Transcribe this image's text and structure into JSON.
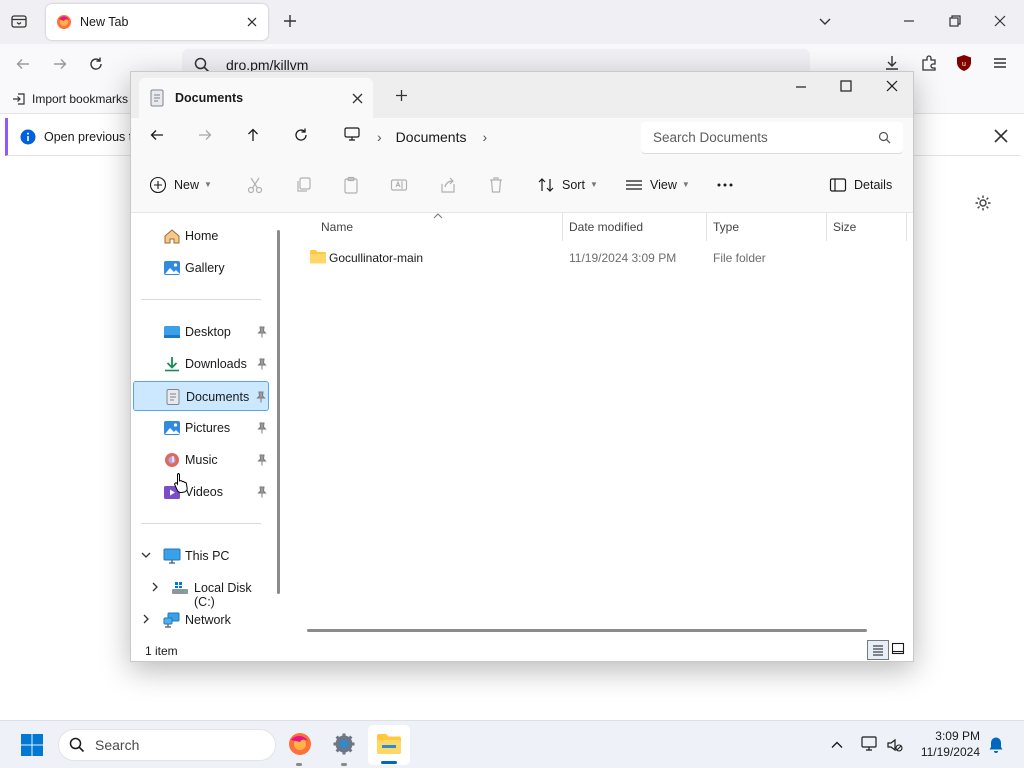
{
  "browser": {
    "tab_title": "New Tab",
    "url": "dro.pm/killvm",
    "bookmark_import": "Import bookmarks",
    "notification": "Open previous ta"
  },
  "explorer": {
    "tab_title": "Documents",
    "breadcrumb": [
      "Documents"
    ],
    "search_placeholder": "Search Documents",
    "commands": {
      "new": "New",
      "sort": "Sort",
      "view": "View",
      "details": "Details"
    },
    "sidebar": {
      "quick": [
        {
          "label": "Home",
          "icon": "home-icon"
        },
        {
          "label": "Gallery",
          "icon": "gallery-icon"
        }
      ],
      "pinned": [
        {
          "label": "Desktop",
          "icon": "desktop-folder-icon"
        },
        {
          "label": "Downloads",
          "icon": "downloads-folder-icon"
        },
        {
          "label": "Documents",
          "icon": "documents-folder-icon",
          "selected": true
        },
        {
          "label": "Pictures",
          "icon": "pictures-folder-icon"
        },
        {
          "label": "Music",
          "icon": "music-folder-icon"
        },
        {
          "label": "Videos",
          "icon": "videos-folder-icon"
        }
      ],
      "tree": [
        {
          "label": "This PC",
          "icon": "this-pc-icon",
          "expanded": true
        },
        {
          "label": "Local Disk (C:)",
          "icon": "drive-icon",
          "expanded": false
        },
        {
          "label": "Network",
          "icon": "network-icon",
          "expanded": false
        }
      ]
    },
    "columns": [
      "Name",
      "Date modified",
      "Type",
      "Size"
    ],
    "files": [
      {
        "name": "Gocullinator-main",
        "date_modified": "11/19/2024 3:09 PM",
        "type": "File folder",
        "size": ""
      }
    ],
    "status": "1 item",
    "accent_color": "#0067c0",
    "selection_color": "#cce8ff"
  },
  "taskbar": {
    "search_placeholder": "Search",
    "time": "3:09 PM",
    "date": "11/19/2024"
  }
}
